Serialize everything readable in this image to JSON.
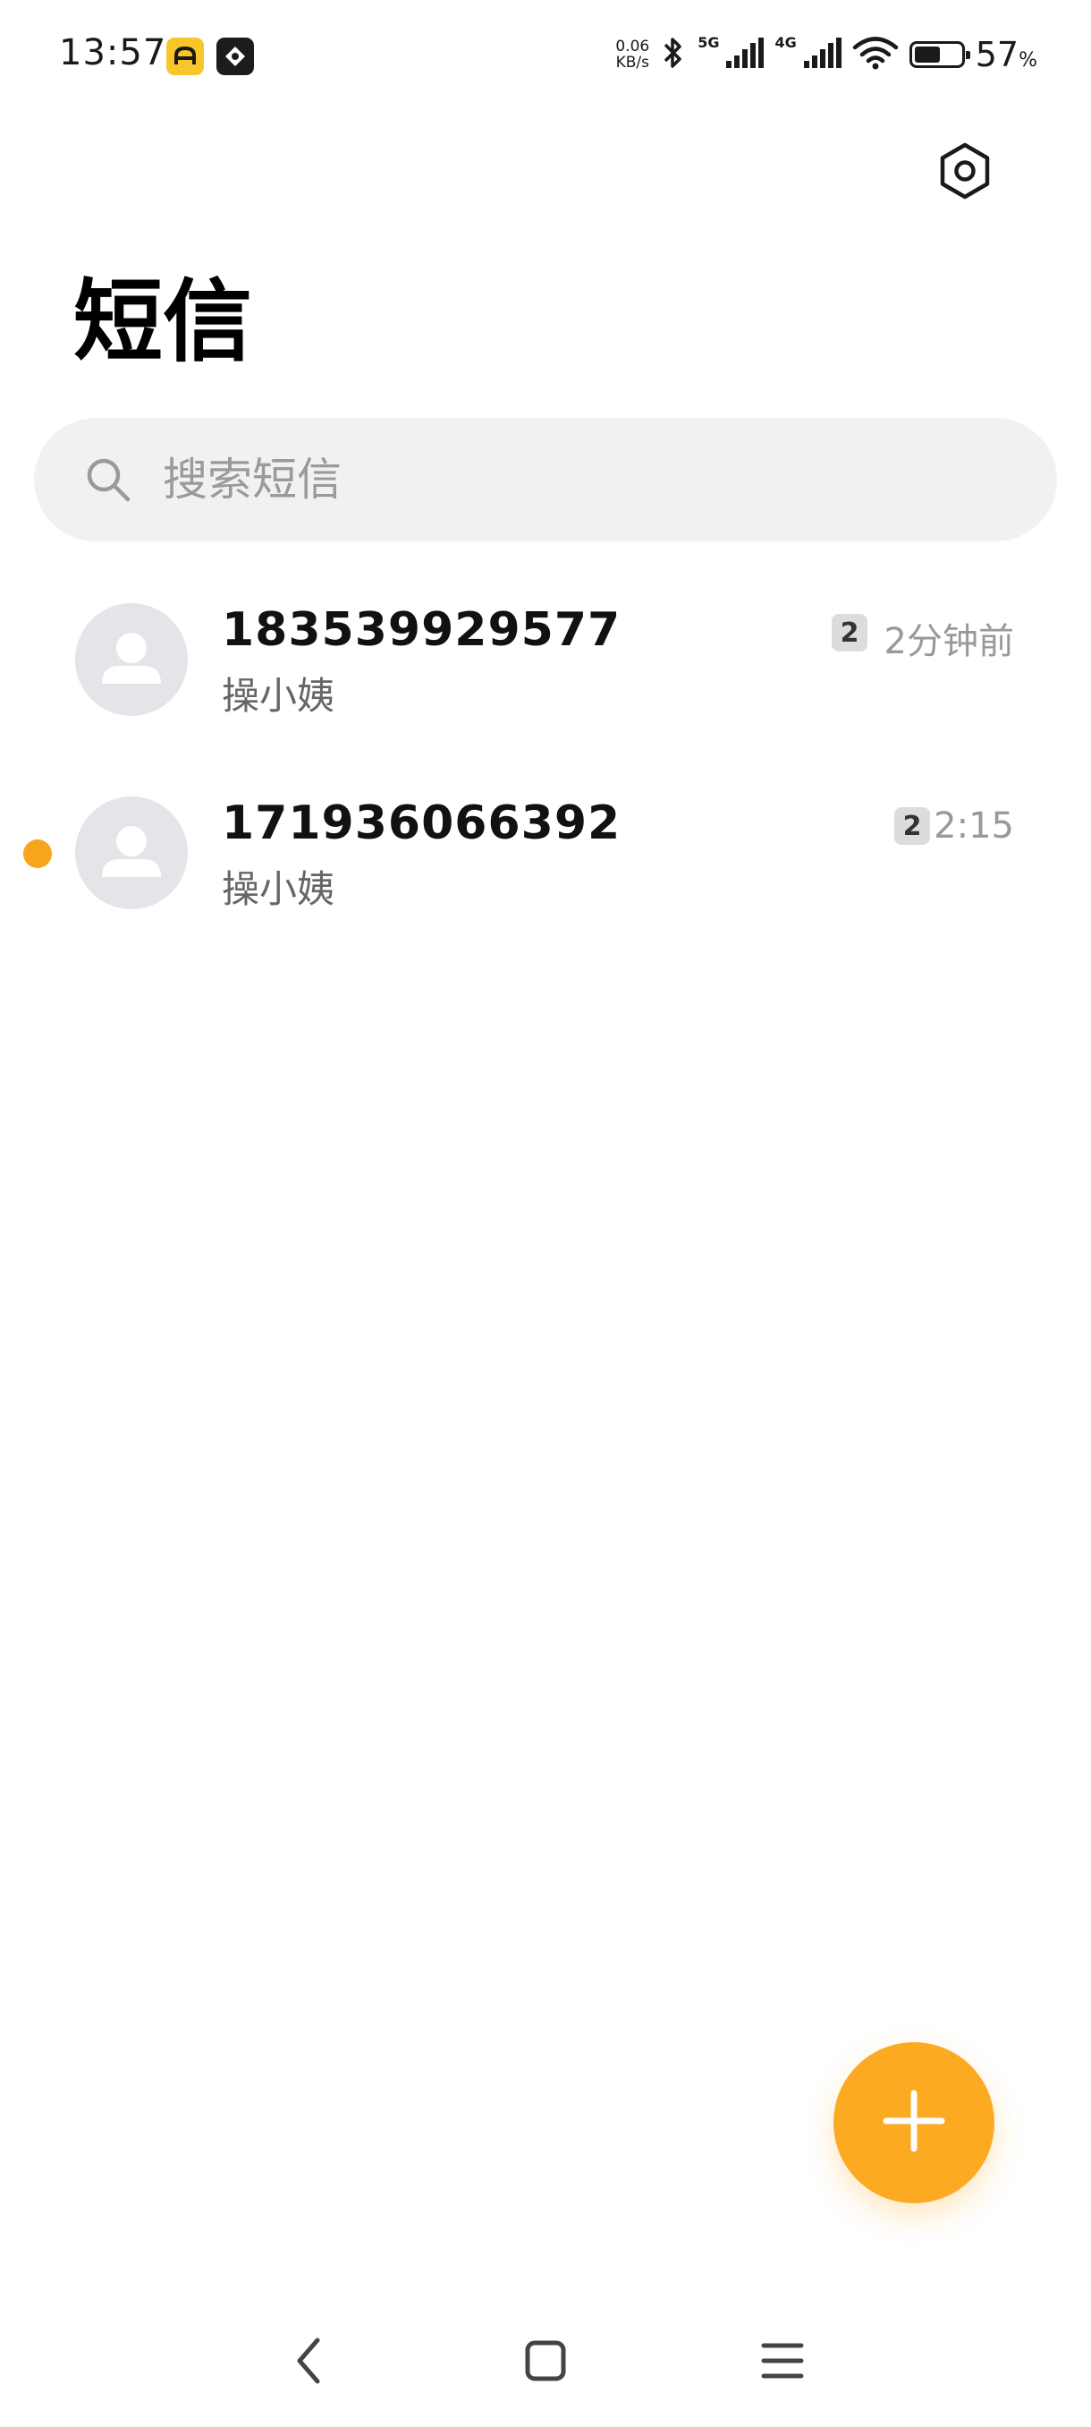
{
  "status_bar": {
    "time": "13:57",
    "net_speed_value": "0.06",
    "net_speed_unit": "KB/s",
    "network_5g": "5G",
    "network_4g": "4G",
    "battery_level": 57,
    "battery_text": "57",
    "battery_unit": "%"
  },
  "header": {
    "title": "短信"
  },
  "search": {
    "placeholder": "搜索短信",
    "value": ""
  },
  "conversations": [
    {
      "name": "183539929577",
      "preview": "操小姨",
      "count": "2",
      "time": "2分钟前",
      "unread": false
    },
    {
      "name": "171936066392",
      "preview": "操小姨",
      "count": "2",
      "time": "2:15",
      "unread": true
    }
  ],
  "colors": {
    "accent": "#fbaa22",
    "unread_dot": "#f7a51d",
    "search_bg": "#f1f1f1",
    "avatar_bg": "#e3e5e8"
  },
  "icons": {
    "settings": "settings-hex-icon",
    "search": "search-icon",
    "compose": "plus-icon",
    "back": "back-chevron-icon",
    "home": "home-square-icon",
    "recents": "menu-lines-icon"
  }
}
